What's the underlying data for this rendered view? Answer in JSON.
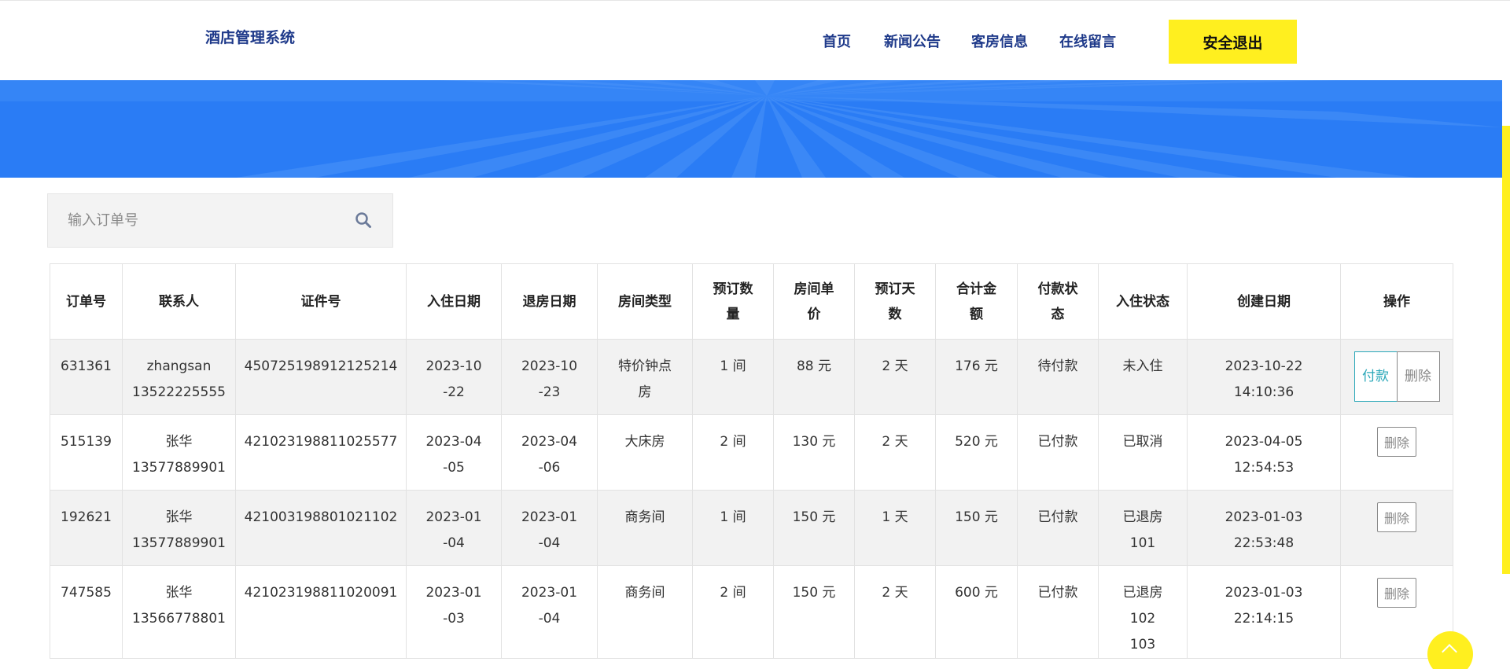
{
  "header": {
    "brand": "酒店管理系统",
    "nav": [
      {
        "label": "首页"
      },
      {
        "label": "新闻公告"
      },
      {
        "label": "客房信息"
      },
      {
        "label": "在线留言"
      }
    ],
    "logout_label": "安全退出"
  },
  "search": {
    "placeholder": "输入订单号",
    "icon": "search-icon"
  },
  "table": {
    "columns": [
      "订单号",
      "联系人",
      "证件号",
      "入住日期",
      "退房日期",
      "房间类型",
      "预订数量",
      "房间单价",
      "预订天数",
      "合计金额",
      "付款状态",
      "入住状态",
      "创建日期",
      "操作"
    ],
    "rows": [
      {
        "order_no": "631361",
        "contact_name": "zhangsan",
        "contact_phone": "13522225555",
        "id_no": "450725198912125214",
        "checkin": "2023-10-22",
        "checkout": "2023-10-23",
        "room_type": "特价钟点房",
        "quantity": "1 间",
        "unit_price": "88 元",
        "days": "2 天",
        "total": "176 元",
        "pay_status": "待付款",
        "stay_status": [
          "未入住"
        ],
        "created_date": "2023-10-22",
        "created_time": "14:10:36",
        "actions": [
          "付款",
          "删除"
        ]
      },
      {
        "order_no": "515139",
        "contact_name": "张华",
        "contact_phone": "13577889901",
        "id_no": "421023198811025577",
        "checkin": "2023-04-05",
        "checkout": "2023-04-06",
        "room_type": "大床房",
        "quantity": "2 间",
        "unit_price": "130 元",
        "days": "2 天",
        "total": "520 元",
        "pay_status": "已付款",
        "stay_status": [
          "已取消"
        ],
        "created_date": "2023-04-05",
        "created_time": "12:54:53",
        "actions": [
          "删除"
        ]
      },
      {
        "order_no": "192621",
        "contact_name": "张华",
        "contact_phone": "13577889901",
        "id_no": "421003198801021102",
        "checkin": "2023-01-04",
        "checkout": "2023-01-04",
        "room_type": "商务间",
        "quantity": "1 间",
        "unit_price": "150 元",
        "days": "1 天",
        "total": "150 元",
        "pay_status": "已付款",
        "stay_status": [
          "已退房",
          "101"
        ],
        "created_date": "2023-01-03",
        "created_time": "22:53:48",
        "actions": [
          "删除"
        ]
      },
      {
        "order_no": "747585",
        "contact_name": "张华",
        "contact_phone": "13566778801",
        "id_no": "421023198811020091",
        "checkin": "2023-01-03",
        "checkout": "2023-01-04",
        "room_type": "商务间",
        "quantity": "2 间",
        "unit_price": "150 元",
        "days": "2 天",
        "total": "600 元",
        "pay_status": "已付款",
        "stay_status": [
          "已退房",
          "102",
          "103"
        ],
        "created_date": "2023-01-03",
        "created_time": "22:14:15",
        "actions": [
          "删除"
        ]
      }
    ]
  },
  "colors": {
    "brand_text": "#1f3a8a",
    "accent_yellow": "#ffef1f",
    "banner_blue": "#2a7cf5",
    "pay_button": "#2aa7b8"
  }
}
